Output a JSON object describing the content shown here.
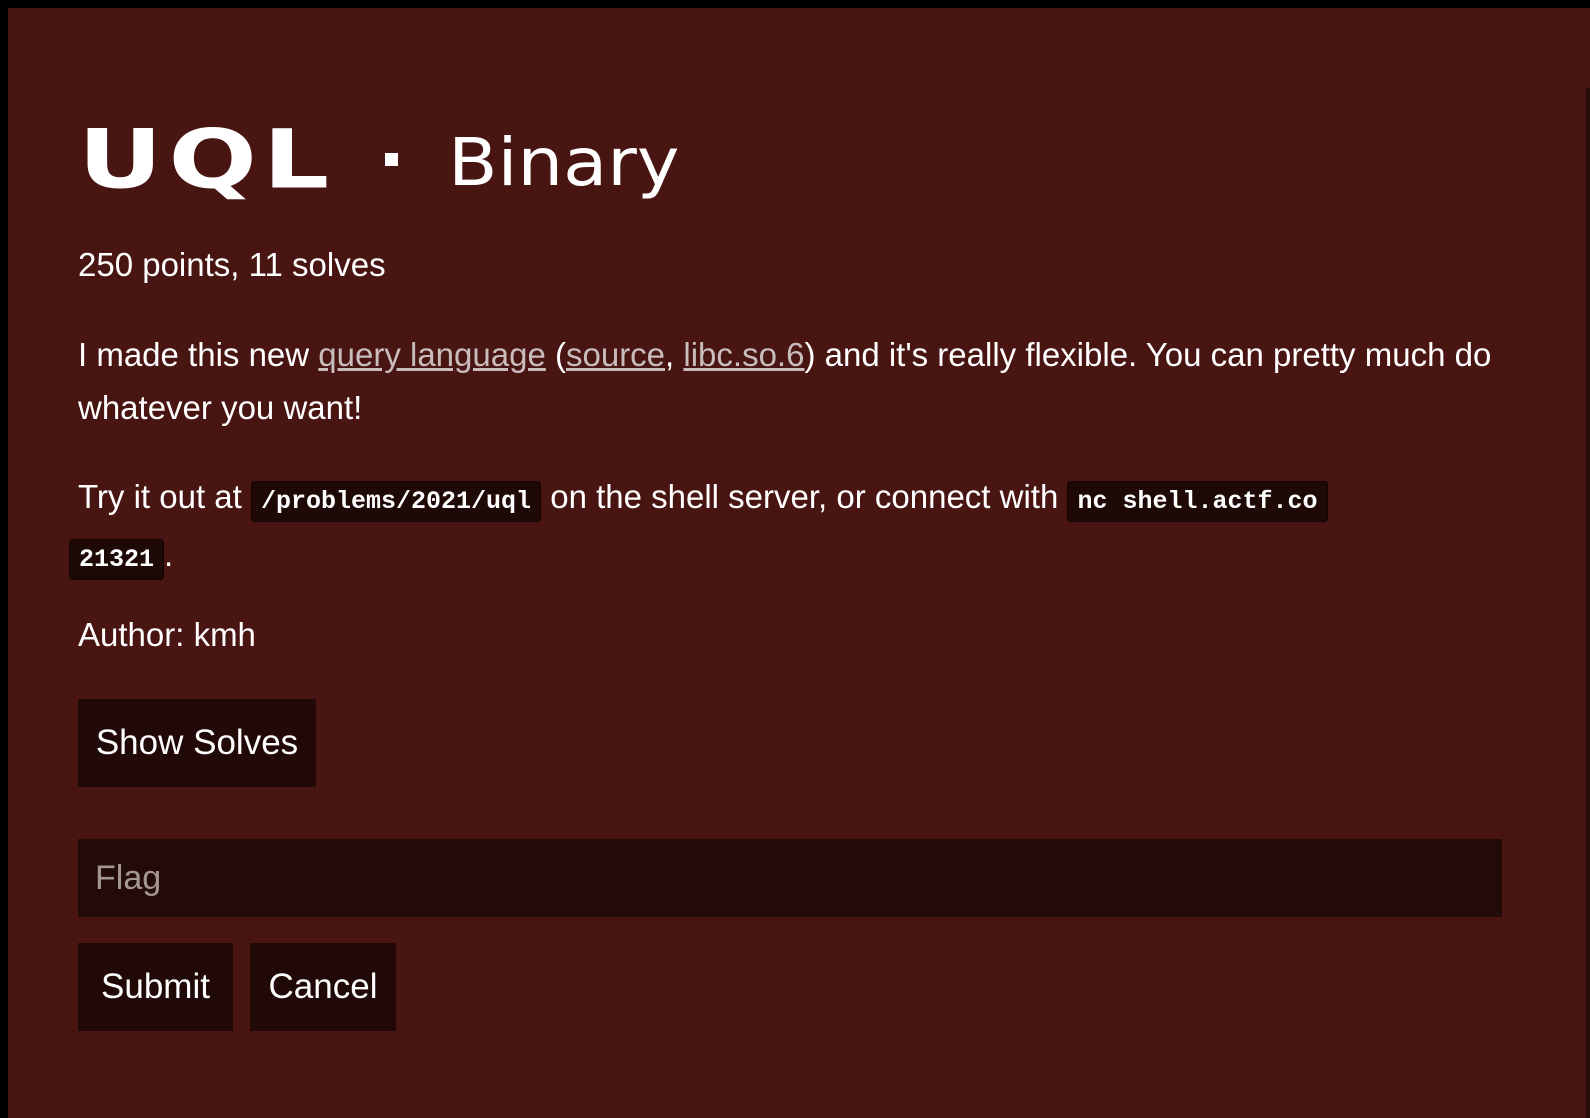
{
  "challenge": {
    "title": "UQL",
    "separator": "·",
    "category": "Binary",
    "points_line": "250 points, 11 solves",
    "description": {
      "part1": "I made this new ",
      "link_query_language": "query language",
      "part2": " (",
      "link_source": "source",
      "part3": ", ",
      "link_libc": "libc.so.6",
      "part4": ") and it's really flexible. You can pretty much do whatever you want!"
    },
    "tryit": {
      "part1": "Try it out at ",
      "path_code": "/problems/2021/uql",
      "part2": " on the shell server, or connect with ",
      "nc_code_line1": "nc shell.actf.co",
      "nc_code_line2": "21321",
      "part3": "."
    },
    "author": "Author: kmh"
  },
  "actions": {
    "show_solves_label": "Show Solves",
    "flag_placeholder": "Flag",
    "submit_label": "Submit",
    "cancel_label": "Cancel"
  },
  "colors": {
    "panel_background": "#481512",
    "button_background": "#200907",
    "input_background": "#230b09",
    "link_color": "#c8bcbc"
  }
}
